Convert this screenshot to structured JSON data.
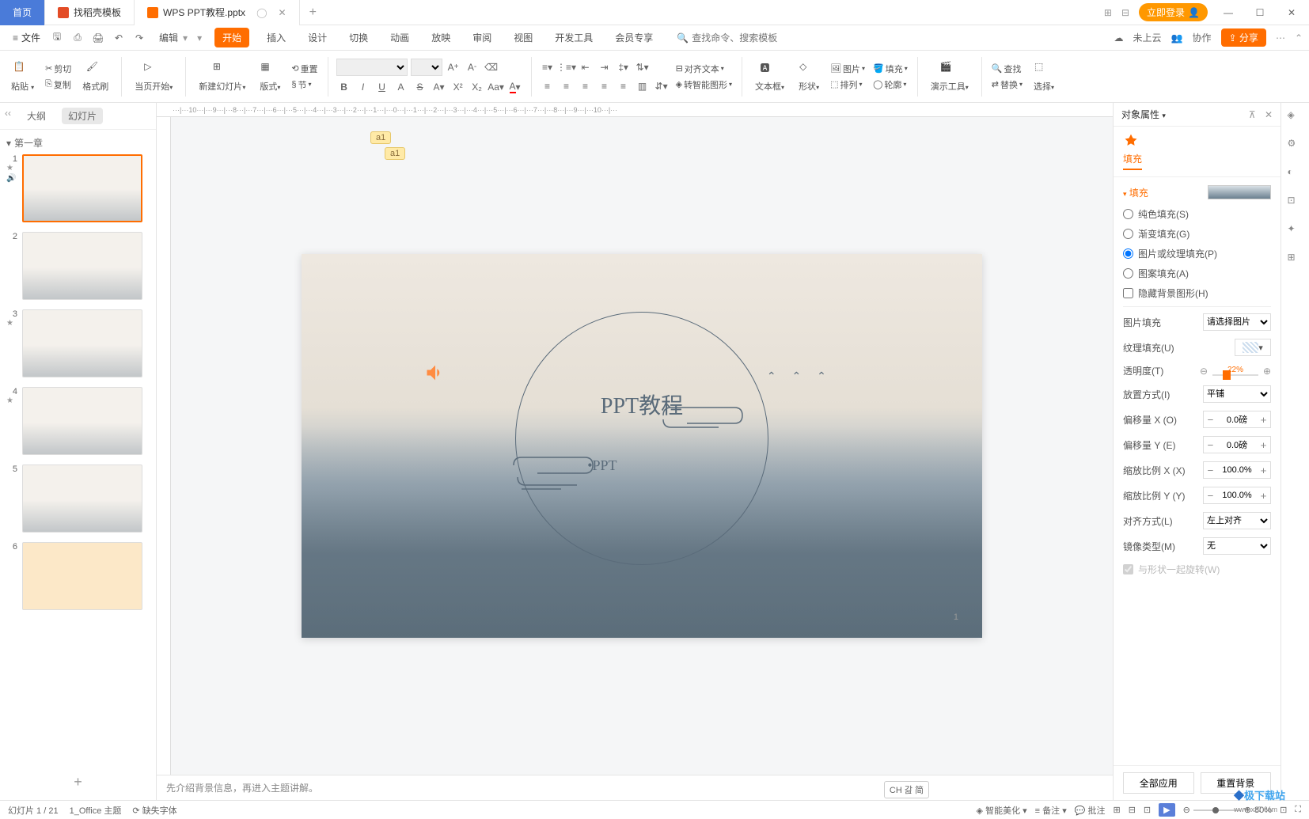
{
  "titlebar": {
    "home_tab": "首页",
    "template_tab": "找稻壳模板",
    "file_tab": "WPS PPT教程.pptx",
    "login": "立即登录"
  },
  "menubar": {
    "file": "文件",
    "edit": "编辑",
    "tabs": [
      "开始",
      "插入",
      "设计",
      "切换",
      "动画",
      "放映",
      "审阅",
      "视图",
      "开发工具",
      "会员专享"
    ],
    "active_tab": "开始",
    "search_placeholder": "查找命令、搜索模板",
    "cloud": "未上云",
    "collab": "协作",
    "share": "分享"
  },
  "ribbon": {
    "paste": "粘贴",
    "cut": "剪切",
    "copy": "复制",
    "format_brush": "格式刷",
    "current_page": "当页开始",
    "new_slide": "新建幻灯片",
    "layout": "版式",
    "reset": "重置",
    "section": "节",
    "align_text": "对齐文本",
    "smart_shape": "转智能图形",
    "text_box": "文本框",
    "shape": "形状",
    "image": "图片",
    "arrange": "排列",
    "fill": "填充",
    "outline": "轮廓",
    "presenter_tools": "演示工具",
    "find": "查找",
    "replace": "替换",
    "select": "选择"
  },
  "outline": {
    "tab_outline": "大纲",
    "tab_slides": "幻灯片",
    "chapter": "第一章",
    "slides": [
      1,
      2,
      3,
      4,
      5,
      6
    ]
  },
  "canvas": {
    "title": "PPT教程",
    "subtitle": "•PPT",
    "page_num": "1",
    "comment1": "a1",
    "comment2": "a1",
    "ruler": "···|···10···|···9···|···8···|···7···|···6···|···5···|···4···|···3···|···2···|···1···|···0···|···1···|···2···|···3···|···4···|···5···|···6···|···7···|···8···|···9···|···10···|···"
  },
  "notes": {
    "text": "先介绍背景信息，再进入主题讲解。"
  },
  "props": {
    "panel_title": "对象属性",
    "tab_fill": "填充",
    "section_fill": "填充",
    "radio_solid": "纯色填充(S)",
    "radio_gradient": "渐变填充(G)",
    "radio_picture": "图片或纹理填充(P)",
    "radio_pattern": "图案填充(A)",
    "check_hide": "隐藏背景图形(H)",
    "picture_fill": "图片填充",
    "picture_fill_val": "请选择图片",
    "texture_fill": "纹理填充(U)",
    "transparency": "透明度(T)",
    "transparency_val": "22%",
    "placement": "放置方式(I)",
    "placement_val": "平铺",
    "offset_x": "偏移量 X (O)",
    "offset_x_val": "0.0磅",
    "offset_y": "偏移量 Y (E)",
    "offset_y_val": "0.0磅",
    "scale_x": "缩放比例 X (X)",
    "scale_x_val": "100.0%",
    "scale_y": "缩放比例 Y (Y)",
    "scale_y_val": "100.0%",
    "alignment": "对齐方式(L)",
    "alignment_val": "左上对齐",
    "mirror": "镜像类型(M)",
    "mirror_val": "无",
    "rotate_with": "与形状一起旋转(W)",
    "apply_all": "全部应用",
    "reset_bg": "重置背景"
  },
  "status": {
    "slide_info": "幻灯片 1 / 21",
    "theme": "1_Office 主题",
    "missing_font": "缺失字体",
    "smart_beautify": "智能美化",
    "notes_btn": "备注",
    "comments_btn": "批注",
    "zoom": "80%",
    "ime": "CH 갎 简"
  },
  "watermark": {
    "main": "极下载站",
    "sub": "www.xz7.com"
  }
}
